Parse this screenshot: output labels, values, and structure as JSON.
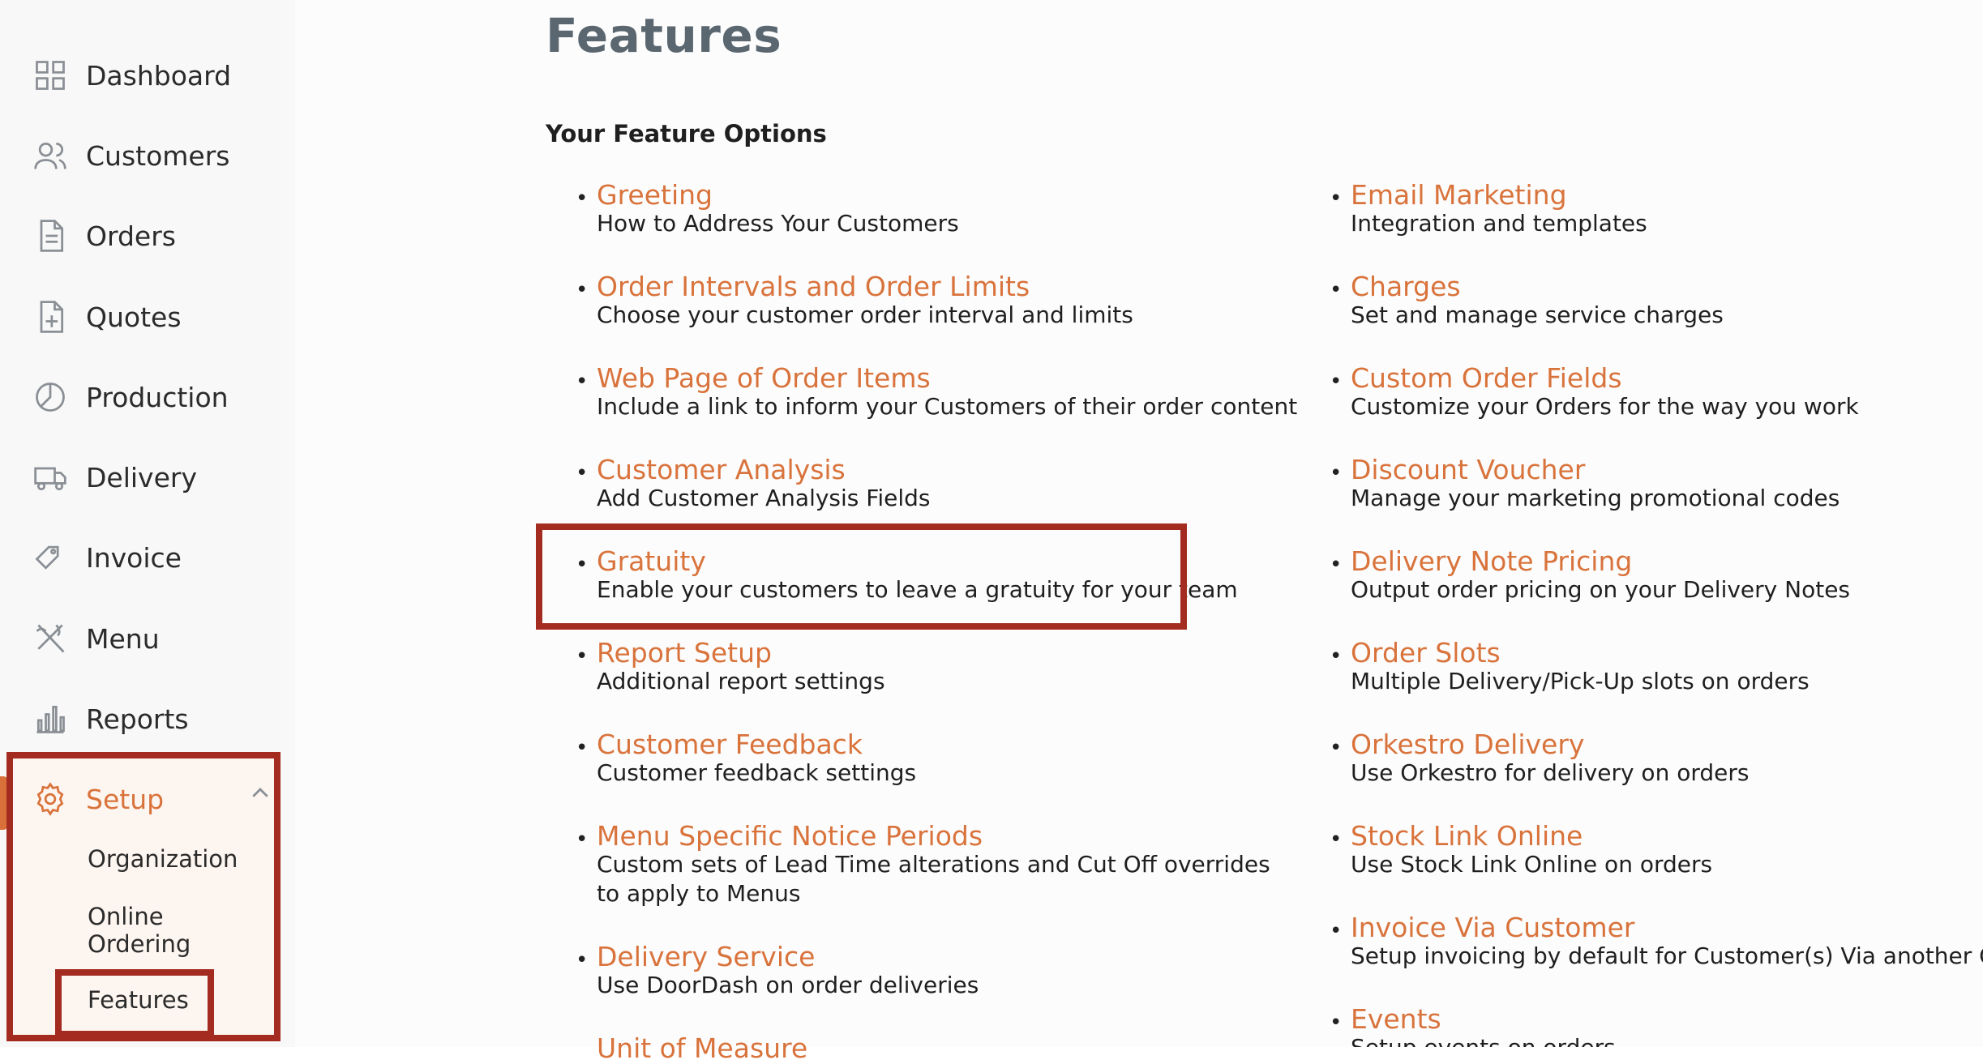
{
  "sidebar": {
    "items": [
      {
        "label": "Dashboard",
        "icon": "dashboard-icon"
      },
      {
        "label": "Customers",
        "icon": "customers-icon"
      },
      {
        "label": "Orders",
        "icon": "orders-icon"
      },
      {
        "label": "Quotes",
        "icon": "quotes-icon"
      },
      {
        "label": "Production",
        "icon": "production-icon"
      },
      {
        "label": "Delivery",
        "icon": "delivery-truck-icon"
      },
      {
        "label": "Invoice",
        "icon": "invoice-tag-icon"
      },
      {
        "label": "Menu",
        "icon": "menu-utensils-icon"
      },
      {
        "label": "Reports",
        "icon": "reports-chart-icon"
      },
      {
        "label": "Setup",
        "icon": "gear-icon",
        "expanded": true
      }
    ],
    "setup_sub": [
      "Organization",
      "Online Ordering",
      "Features"
    ],
    "active_sub": "Features",
    "accent_color": "#d9733c"
  },
  "main": {
    "title": "Features",
    "section_title": "Your Feature Options",
    "left_features": [
      {
        "name": "Greeting",
        "desc": "How to Address Your Customers"
      },
      {
        "name": "Order Intervals and Order Limits",
        "desc": "Choose your customer order interval and limits"
      },
      {
        "name": "Web Page of Order Items",
        "desc": "Include a link to inform your Customers of their order content"
      },
      {
        "name": "Customer Analysis",
        "desc": "Add Customer Analysis Fields"
      },
      {
        "name": "Gratuity",
        "desc": "Enable your customers to leave a gratuity for your team"
      },
      {
        "name": "Report Setup",
        "desc": "Additional report settings"
      },
      {
        "name": "Customer Feedback",
        "desc": "Customer feedback settings"
      },
      {
        "name": "Menu Specific Notice Periods",
        "desc": "Custom sets of Lead Time alterations and Cut Off overrides to apply to Menus"
      },
      {
        "name": "Delivery Service",
        "desc": "Use DoorDash on order deliveries"
      },
      {
        "name": "Unit of Measure",
        "desc": ""
      }
    ],
    "right_features": [
      {
        "name": "Email Marketing",
        "desc": "Integration and templates"
      },
      {
        "name": "Charges",
        "desc": "Set and manage service charges"
      },
      {
        "name": "Custom Order Fields",
        "desc": "Customize your Orders for the way you work"
      },
      {
        "name": "Discount Voucher",
        "desc": "Manage your marketing promotional codes"
      },
      {
        "name": "Delivery Note Pricing",
        "desc": "Output order pricing on your Delivery Notes"
      },
      {
        "name": "Order Slots",
        "desc": "Multiple Delivery/Pick-Up slots on orders"
      },
      {
        "name": "Orkestro Delivery",
        "desc": "Use Orkestro for delivery on orders"
      },
      {
        "name": "Stock Link Online",
        "desc": "Use Stock Link Online on orders"
      },
      {
        "name": "Invoice Via Customer",
        "desc": "Setup invoicing by default for Customer(s) Via another Custome"
      },
      {
        "name": "Events",
        "desc": "Setup events on orders"
      }
    ],
    "link_color": "#d9733c",
    "highlight_color": "#a32b20"
  }
}
